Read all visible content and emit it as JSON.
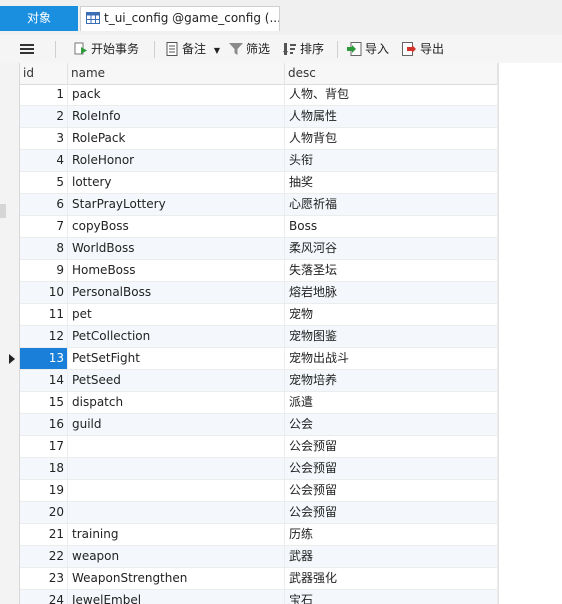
{
  "tabs": {
    "objects_label": "对象",
    "active_label": "t_ui_config @game_config (..."
  },
  "toolbar": {
    "menu_icon": "hamburger-icon",
    "begin_transaction": "开始事务",
    "note": "备注",
    "filter": "筛选",
    "sort": "排序",
    "import": "导入",
    "export": "导出"
  },
  "grid": {
    "columns": [
      "id",
      "name",
      "desc"
    ],
    "selected_id": "13",
    "rows": [
      {
        "id": "1",
        "name": "pack",
        "desc": "人物、背包"
      },
      {
        "id": "2",
        "name": "RoleInfo",
        "desc": "人物属性"
      },
      {
        "id": "3",
        "name": "RolePack",
        "desc": "人物背包"
      },
      {
        "id": "4",
        "name": "RoleHonor",
        "desc": "头衔"
      },
      {
        "id": "5",
        "name": "lottery",
        "desc": "抽奖"
      },
      {
        "id": "6",
        "name": "StarPrayLottery",
        "desc": "心愿祈福"
      },
      {
        "id": "7",
        "name": "copyBoss",
        "desc": "Boss"
      },
      {
        "id": "8",
        "name": "WorldBoss",
        "desc": "柔风河谷"
      },
      {
        "id": "9",
        "name": "HomeBoss",
        "desc": "失落圣坛"
      },
      {
        "id": "10",
        "name": "PersonalBoss",
        "desc": "熔岩地脉"
      },
      {
        "id": "11",
        "name": "pet",
        "desc": "宠物"
      },
      {
        "id": "12",
        "name": "PetCollection",
        "desc": "宠物图鉴"
      },
      {
        "id": "13",
        "name": "PetSetFight",
        "desc": "宠物出战斗"
      },
      {
        "id": "14",
        "name": "PetSeed",
        "desc": "宠物培养"
      },
      {
        "id": "15",
        "name": "dispatch",
        "desc": "派遣"
      },
      {
        "id": "16",
        "name": "guild",
        "desc": "公会"
      },
      {
        "id": "17",
        "name": "",
        "desc": "公会预留"
      },
      {
        "id": "18",
        "name": "",
        "desc": "公会预留"
      },
      {
        "id": "19",
        "name": "",
        "desc": "公会预留"
      },
      {
        "id": "20",
        "name": "",
        "desc": "公会预留"
      },
      {
        "id": "21",
        "name": "training",
        "desc": "历练"
      },
      {
        "id": "22",
        "name": "weapon",
        "desc": "武器"
      },
      {
        "id": "23",
        "name": "WeaponStrengthen",
        "desc": "武器强化"
      },
      {
        "id": "24",
        "name": "JewelEmbel",
        "desc": "宝石"
      }
    ]
  }
}
